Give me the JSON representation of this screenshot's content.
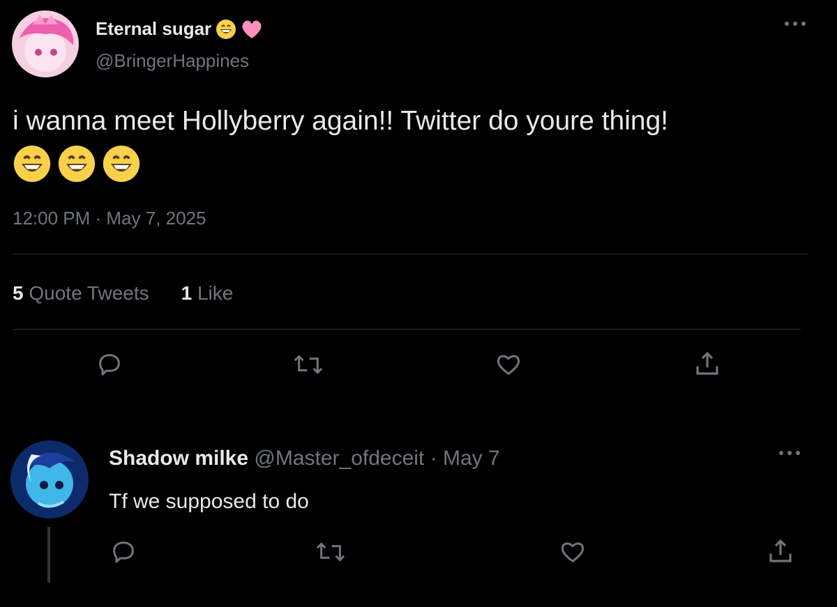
{
  "tweet": {
    "display_name": "Eternal sugar",
    "handle": "@BringerHappines",
    "text": "i wanna meet Hollyberry again!! Twitter do youre thing!",
    "timestamp": "12:00 PM · May 7, 2025",
    "stats": {
      "quote_tweets_count": "5",
      "quote_tweets_label": "Quote Tweets",
      "likes_count": "1",
      "likes_label": "Like"
    }
  },
  "reply": {
    "display_name": "Shadow milke",
    "handle_date": "@Master_ofdeceit · May 7",
    "text": "Tf we supposed to do"
  },
  "icons": [
    "more-icon",
    "grinning-emoji-icon",
    "pink-heart-emoji-icon",
    "reply-icon",
    "retweet-icon",
    "like-icon",
    "share-icon"
  ],
  "colors": {
    "background": "#000000",
    "text": "#e7e9ea",
    "secondary": "#71767b",
    "divider": "#2f3336"
  }
}
